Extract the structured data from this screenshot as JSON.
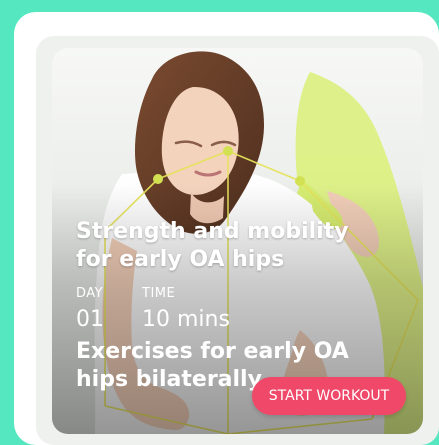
{
  "card": {
    "title": "Strength and mobility for early OA hips",
    "day_label": "DAY",
    "day_value": "01",
    "time_label": "TIME",
    "time_value": "10 mins",
    "subtitle": "Exercises for early OA hips bilaterally",
    "cta_label": "START WORKOUT"
  },
  "colors": {
    "background": "#55e8c0",
    "cta": "#f04869",
    "pose_overlay": "#e6e35a",
    "shirt": "#ffffff",
    "assistant_garment": "#d8ef7a"
  }
}
